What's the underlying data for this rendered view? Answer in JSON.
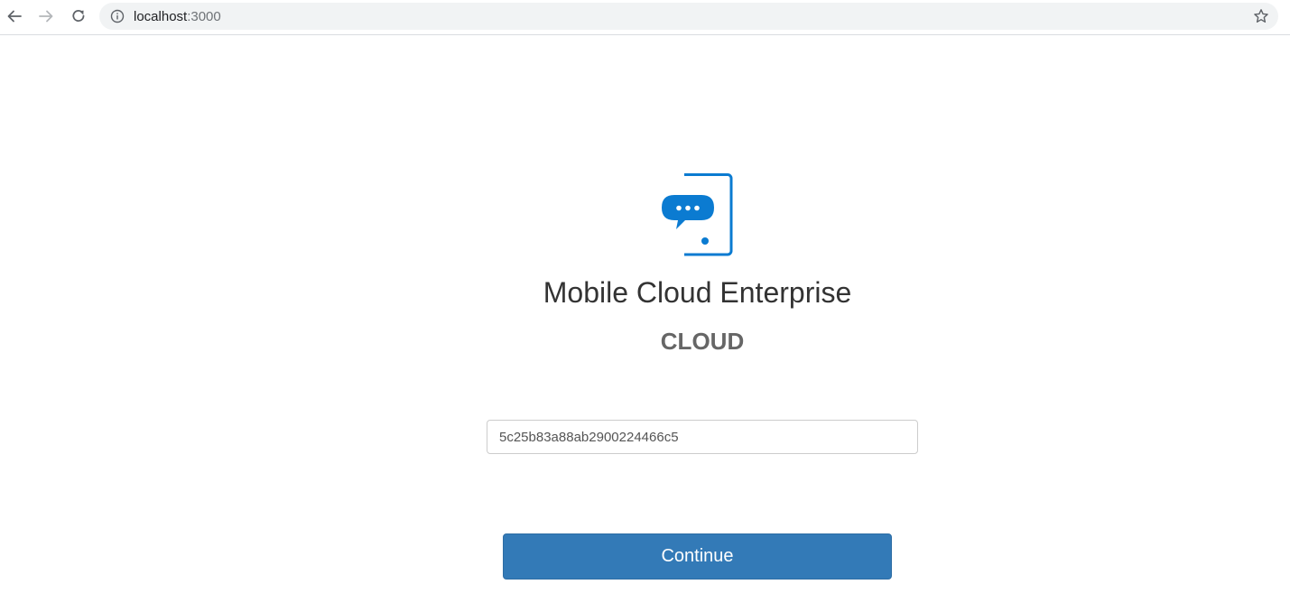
{
  "browser": {
    "url_host": "localhost",
    "url_port": ":3000",
    "icons": {
      "back": "arrow-left-icon",
      "forward": "arrow-right-icon",
      "reload": "reload-icon",
      "site_info": "info-icon",
      "bookmark": "star-icon"
    }
  },
  "app": {
    "logo": "mobile-chat-logo",
    "title": "Mobile Cloud Enterprise",
    "subtitle": "CLOUD",
    "token_value": "5c25b83a88ab2900224466c5",
    "continue_label": "Continue",
    "colors": {
      "accent": "#337ab7",
      "logo_blue": "#0b7bd1",
      "title": "#333333",
      "subtitle": "#666666"
    }
  }
}
